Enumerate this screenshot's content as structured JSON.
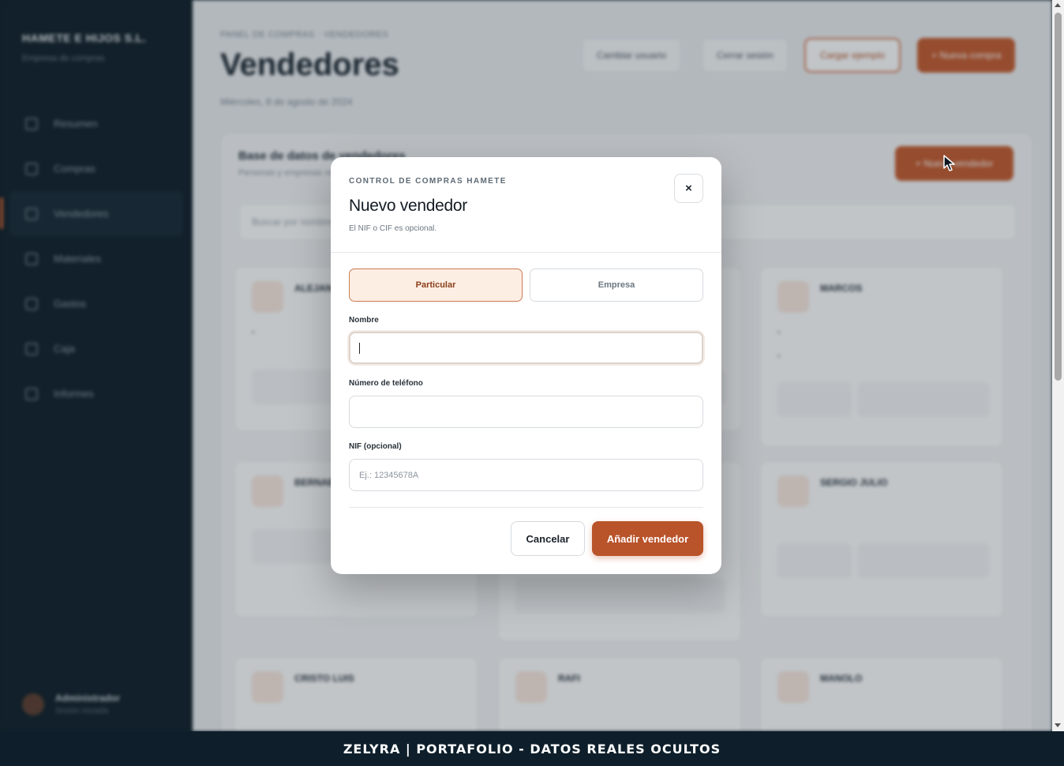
{
  "background": {
    "brand": "HAMETE E HIJOS S.L.",
    "brand_sub": "Empresa de compras",
    "nav": [
      "Resumen",
      "Compras",
      "Vendedores",
      "Materiales",
      "Gastos",
      "Caja",
      "Informes"
    ],
    "nav_active_index": 2,
    "user_name": "Administrador",
    "user_role": "Sesión iniciada",
    "breadcrumb": "PANEL DE COMPRAS · VENDEDORES",
    "page_title": "Vendedores",
    "page_date": "Miércoles, 8 de agosto de 2024",
    "top_buttons": [
      "Cambiar usuario",
      "Cerrar sesión",
      "Cargar ejemplo",
      "+ Nueva compra"
    ],
    "panel_title": "Base de datos de vendedores",
    "panel_sub": "Personas y empresas registradas",
    "panel_button": "+ Nuevo vendedor",
    "search_placeholder": "Buscar por nombre...",
    "vendor_names": [
      "ALEJANDRO",
      "BERNABÉ",
      "MARCOS",
      "SERGIO JULIO",
      "CRISTO LUIS",
      "RAFI",
      "MANOLO"
    ]
  },
  "modal": {
    "eyebrow": "CONTROL DE COMPRAS HAMETE",
    "title": "Nuevo vendedor",
    "subtitle": "El NIF o CIF es opcional.",
    "close_label": "×",
    "segments": {
      "particular": "Particular",
      "empresa": "Empresa"
    },
    "fields": {
      "nombre": {
        "label": "Nombre",
        "value": "",
        "placeholder": ""
      },
      "telefono": {
        "label": "Número de teléfono",
        "value": "",
        "placeholder": ""
      },
      "nif": {
        "label": "NIF (opcional)",
        "value": "",
        "placeholder": "Ej.: 12345678A"
      }
    },
    "cancel_label": "Cancelar",
    "submit_label": "Añadir vendedor"
  },
  "footer": {
    "text": "ZELYRA | PORTAFOLIO - DATOS REALES OCULTOS"
  },
  "colors": {
    "accent": "#b9532a",
    "sidebar": "#0c1b24",
    "footer": "#0e1f2b"
  }
}
